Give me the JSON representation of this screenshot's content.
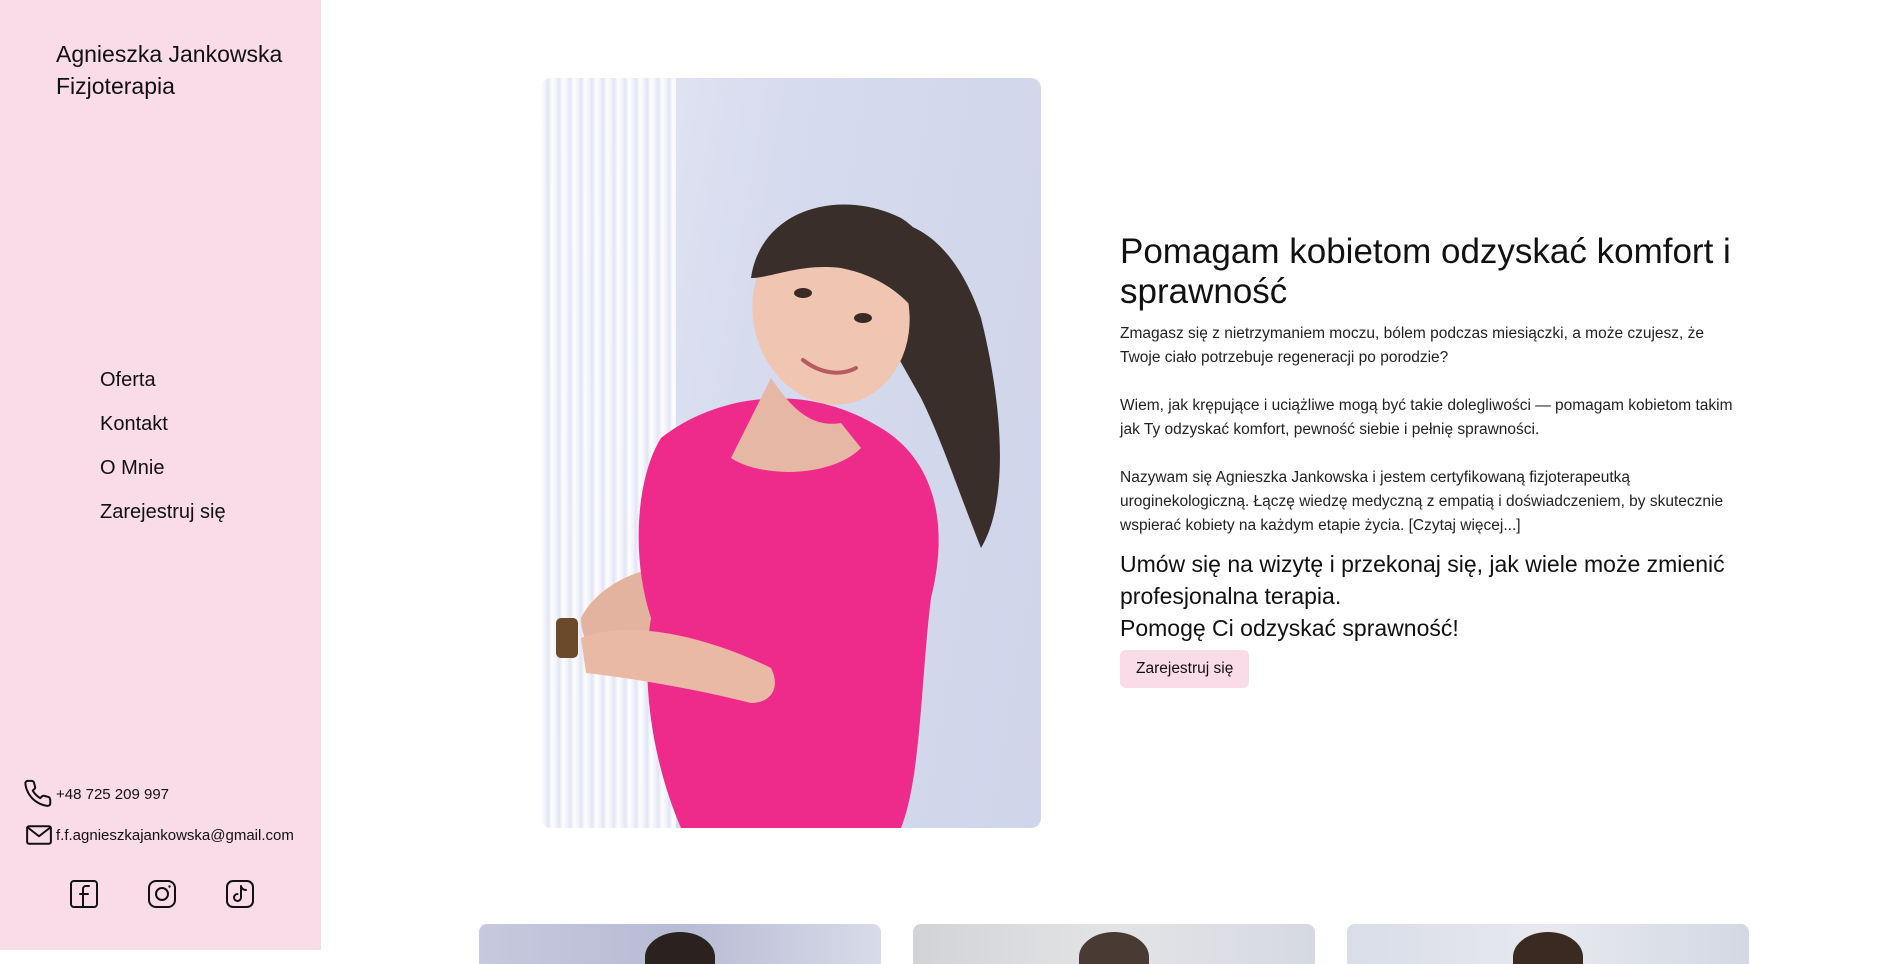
{
  "brand": {
    "line1": "Agnieszka Jankowska",
    "line2": "Fizjoterapia"
  },
  "nav": {
    "items": [
      {
        "label": "Oferta"
      },
      {
        "label": "Kontakt"
      },
      {
        "label": "O Mnie"
      },
      {
        "label": "Zarejestruj się"
      }
    ]
  },
  "contact": {
    "phone": "+48 725 209 997",
    "email": "f.f.agnieszkajankowska@gmail.com"
  },
  "socials": [
    {
      "icon": "facebook-icon"
    },
    {
      "icon": "instagram-icon"
    },
    {
      "icon": "tiktok-icon"
    }
  ],
  "hero": {
    "headline": "Pomagam kobietom odzyskać komfort i sprawność",
    "paragraphs": [
      "Zmagasz się z nietrzymaniem moczu, bólem podczas miesiączki, a może czujesz, że Twoje ciało potrzebuje regeneracji po porodzie?",
      "Wiem, jak krępujące i uciążliwe mogą być takie dolegliwości — pomagam kobietom takim jak Ty odzyskać komfort, pewność siebie i pełnię sprawności.",
      "Nazywam się Agnieszka Jankowska i jestem certyfikowaną fizjoterapeutką uroginekologiczną. Łączę wiedzę medyczną z empatią i doświadczeniem, by skutecznie wspierać kobiety na każdym etapie życia. [Czytaj więcej...]"
    ],
    "cta_line1": "Umów się na wizytę i przekonaj się, jak wiele może zmienić profesjonalna terapia.",
    "cta_line2": "Pomogę Ci odzyskać sprawność!",
    "cta_button": "Zarejestruj się"
  },
  "colors": {
    "sidebar_bg": "#fadbe8",
    "accent": "#fadbe8",
    "shirt": "#ee2b8a"
  }
}
